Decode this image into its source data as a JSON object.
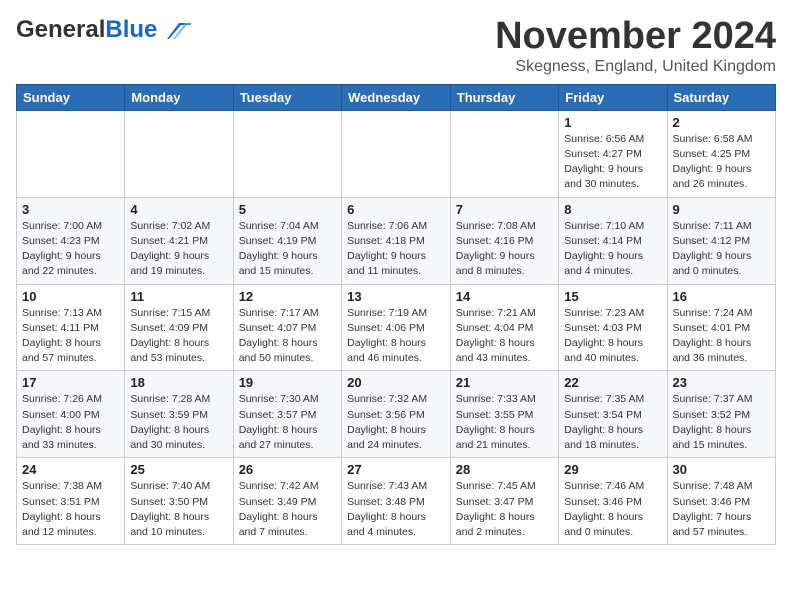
{
  "header": {
    "logo_general": "General",
    "logo_blue": "Blue",
    "month_title": "November 2024",
    "location": "Skegness, England, United Kingdom"
  },
  "weekdays": [
    "Sunday",
    "Monday",
    "Tuesday",
    "Wednesday",
    "Thursday",
    "Friday",
    "Saturday"
  ],
  "weeks": [
    [
      {
        "day": "",
        "info": ""
      },
      {
        "day": "",
        "info": ""
      },
      {
        "day": "",
        "info": ""
      },
      {
        "day": "",
        "info": ""
      },
      {
        "day": "",
        "info": ""
      },
      {
        "day": "1",
        "info": "Sunrise: 6:56 AM\nSunset: 4:27 PM\nDaylight: 9 hours and 30 minutes."
      },
      {
        "day": "2",
        "info": "Sunrise: 6:58 AM\nSunset: 4:25 PM\nDaylight: 9 hours and 26 minutes."
      }
    ],
    [
      {
        "day": "3",
        "info": "Sunrise: 7:00 AM\nSunset: 4:23 PM\nDaylight: 9 hours and 22 minutes."
      },
      {
        "day": "4",
        "info": "Sunrise: 7:02 AM\nSunset: 4:21 PM\nDaylight: 9 hours and 19 minutes."
      },
      {
        "day": "5",
        "info": "Sunrise: 7:04 AM\nSunset: 4:19 PM\nDaylight: 9 hours and 15 minutes."
      },
      {
        "day": "6",
        "info": "Sunrise: 7:06 AM\nSunset: 4:18 PM\nDaylight: 9 hours and 11 minutes."
      },
      {
        "day": "7",
        "info": "Sunrise: 7:08 AM\nSunset: 4:16 PM\nDaylight: 9 hours and 8 minutes."
      },
      {
        "day": "8",
        "info": "Sunrise: 7:10 AM\nSunset: 4:14 PM\nDaylight: 9 hours and 4 minutes."
      },
      {
        "day": "9",
        "info": "Sunrise: 7:11 AM\nSunset: 4:12 PM\nDaylight: 9 hours and 0 minutes."
      }
    ],
    [
      {
        "day": "10",
        "info": "Sunrise: 7:13 AM\nSunset: 4:11 PM\nDaylight: 8 hours and 57 minutes."
      },
      {
        "day": "11",
        "info": "Sunrise: 7:15 AM\nSunset: 4:09 PM\nDaylight: 8 hours and 53 minutes."
      },
      {
        "day": "12",
        "info": "Sunrise: 7:17 AM\nSunset: 4:07 PM\nDaylight: 8 hours and 50 minutes."
      },
      {
        "day": "13",
        "info": "Sunrise: 7:19 AM\nSunset: 4:06 PM\nDaylight: 8 hours and 46 minutes."
      },
      {
        "day": "14",
        "info": "Sunrise: 7:21 AM\nSunset: 4:04 PM\nDaylight: 8 hours and 43 minutes."
      },
      {
        "day": "15",
        "info": "Sunrise: 7:23 AM\nSunset: 4:03 PM\nDaylight: 8 hours and 40 minutes."
      },
      {
        "day": "16",
        "info": "Sunrise: 7:24 AM\nSunset: 4:01 PM\nDaylight: 8 hours and 36 minutes."
      }
    ],
    [
      {
        "day": "17",
        "info": "Sunrise: 7:26 AM\nSunset: 4:00 PM\nDaylight: 8 hours and 33 minutes."
      },
      {
        "day": "18",
        "info": "Sunrise: 7:28 AM\nSunset: 3:59 PM\nDaylight: 8 hours and 30 minutes."
      },
      {
        "day": "19",
        "info": "Sunrise: 7:30 AM\nSunset: 3:57 PM\nDaylight: 8 hours and 27 minutes."
      },
      {
        "day": "20",
        "info": "Sunrise: 7:32 AM\nSunset: 3:56 PM\nDaylight: 8 hours and 24 minutes."
      },
      {
        "day": "21",
        "info": "Sunrise: 7:33 AM\nSunset: 3:55 PM\nDaylight: 8 hours and 21 minutes."
      },
      {
        "day": "22",
        "info": "Sunrise: 7:35 AM\nSunset: 3:54 PM\nDaylight: 8 hours and 18 minutes."
      },
      {
        "day": "23",
        "info": "Sunrise: 7:37 AM\nSunset: 3:52 PM\nDaylight: 8 hours and 15 minutes."
      }
    ],
    [
      {
        "day": "24",
        "info": "Sunrise: 7:38 AM\nSunset: 3:51 PM\nDaylight: 8 hours and 12 minutes."
      },
      {
        "day": "25",
        "info": "Sunrise: 7:40 AM\nSunset: 3:50 PM\nDaylight: 8 hours and 10 minutes."
      },
      {
        "day": "26",
        "info": "Sunrise: 7:42 AM\nSunset: 3:49 PM\nDaylight: 8 hours and 7 minutes."
      },
      {
        "day": "27",
        "info": "Sunrise: 7:43 AM\nSunset: 3:48 PM\nDaylight: 8 hours and 4 minutes."
      },
      {
        "day": "28",
        "info": "Sunrise: 7:45 AM\nSunset: 3:47 PM\nDaylight: 8 hours and 2 minutes."
      },
      {
        "day": "29",
        "info": "Sunrise: 7:46 AM\nSunset: 3:46 PM\nDaylight: 8 hours and 0 minutes."
      },
      {
        "day": "30",
        "info": "Sunrise: 7:48 AM\nSunset: 3:46 PM\nDaylight: 7 hours and 57 minutes."
      }
    ]
  ]
}
